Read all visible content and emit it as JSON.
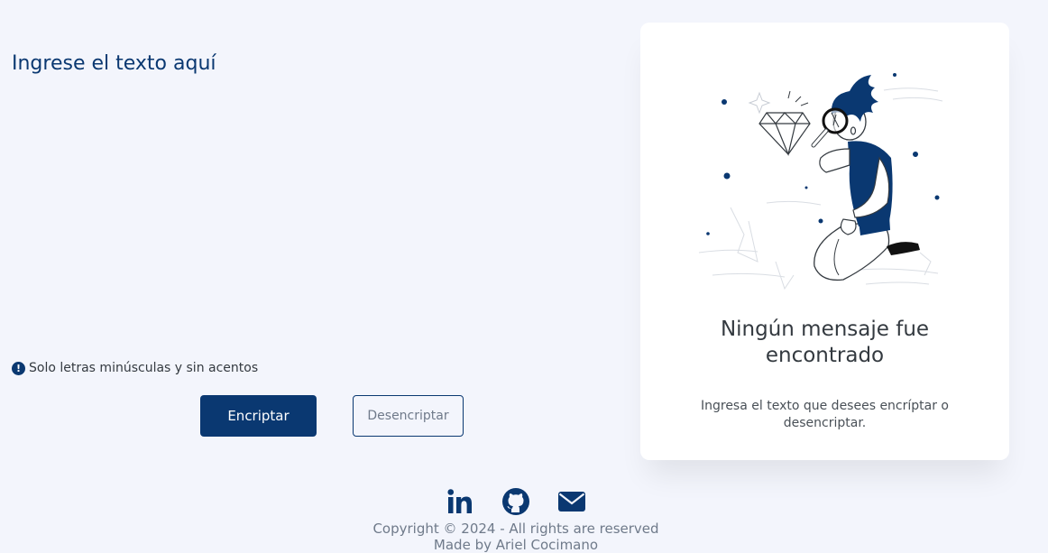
{
  "input": {
    "placeholder": "Ingrese el texto aquí",
    "value": ""
  },
  "hint": {
    "icon": "info-circle-icon",
    "text": "Solo letras minúsculas y sin acentos"
  },
  "buttons": {
    "encrypt_label": "Encriptar",
    "decrypt_label": "Desencriptar"
  },
  "result_card": {
    "illustration": "person-with-magnifier-illustration",
    "title": "Ningún mensaje fue encontrado",
    "text": "Ingresa el texto que desees encríptar o desencriptar."
  },
  "footer": {
    "icons": [
      "linkedin-icon",
      "github-icon",
      "email-icon"
    ],
    "copyright": "Copyright © 2024 - All rights are reserved",
    "author": "Made by Ariel Cocimano"
  },
  "colors": {
    "background": "#f3f5fc",
    "accent": "#0a3871",
    "card": "#ffffff"
  }
}
